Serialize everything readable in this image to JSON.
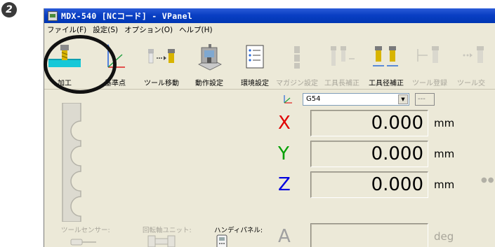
{
  "step_number": "2",
  "window": {
    "title": "MDX-540 [NCコード] - VPanel"
  },
  "menu": [
    "ファイル(F)",
    "設定(S)",
    "オプション(O)",
    "ヘルプ(H)"
  ],
  "toolbar": [
    {
      "label": "加工",
      "icon": "mill-cutting-icon",
      "enabled": true,
      "highlighted": true
    },
    {
      "label": "基準点",
      "icon": "origin-axes-icon",
      "enabled": true
    },
    {
      "label": "ツール移動",
      "icon": "tool-move-icon",
      "enabled": true
    },
    {
      "label": "動作設定",
      "icon": "machine-settings-icon",
      "enabled": true
    },
    {
      "label": "環境設定",
      "icon": "environment-settings-icon",
      "enabled": true
    },
    {
      "label": "マガジン設定",
      "icon": "magazine-icon",
      "enabled": false
    },
    {
      "label": "工具長補正",
      "icon": "tool-length-icon",
      "enabled": false
    },
    {
      "label": "工具径補正",
      "icon": "tool-diameter-icon",
      "enabled": true
    },
    {
      "label": "ツール登録",
      "icon": "tool-register-icon",
      "enabled": false
    },
    {
      "label": "ツール交",
      "icon": "tool-change-icon",
      "enabled": false
    }
  ],
  "coordinate_system": {
    "selected": "G54",
    "extra_value": "---"
  },
  "coordinates": [
    {
      "axis": "X",
      "value": "0.000",
      "unit": "mm",
      "color": "#e00000"
    },
    {
      "axis": "Y",
      "value": "0.000",
      "unit": "mm",
      "color": "#00a000"
    },
    {
      "axis": "Z",
      "value": "0.000",
      "unit": "mm",
      "color": "#0000e0"
    },
    {
      "axis": "A",
      "value": "",
      "unit": "deg",
      "color": "#a0a0a0"
    }
  ],
  "accessories": [
    {
      "label": "ツールセンサー:",
      "enabled": false
    },
    {
      "label": "回転軸ユニット:",
      "enabled": false
    },
    {
      "label": "ハンディパネル:",
      "enabled": true
    }
  ],
  "colors": {
    "titlebar": "#0a3fc4",
    "window_bg": "#ece9d8",
    "highlight_ring": "#111111"
  }
}
